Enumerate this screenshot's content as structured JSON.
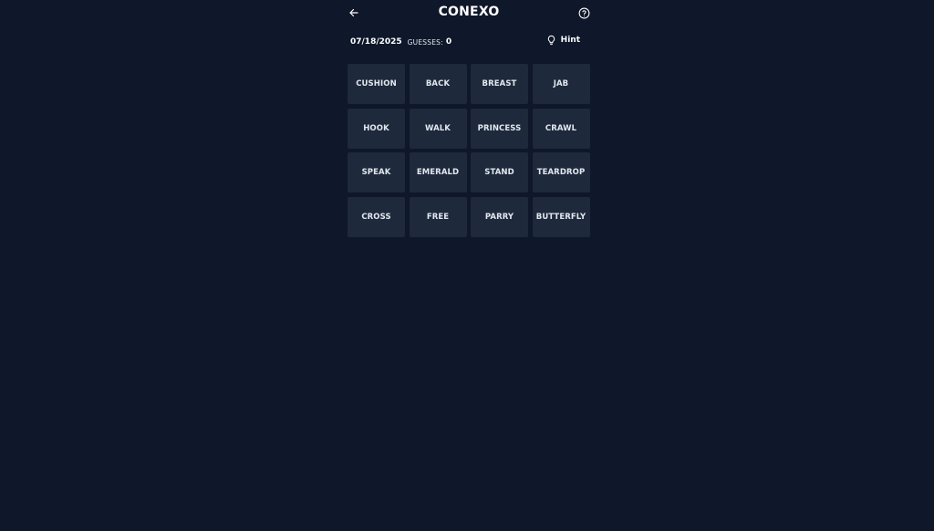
{
  "header": {
    "title": "CONEXO",
    "back_icon": "arrow-left-icon",
    "help_icon": "question-circle-icon"
  },
  "meta": {
    "date": "07/18/2025",
    "guesses_label": "GUESSES:",
    "guesses_count": "0",
    "hint_label": "Hint",
    "hint_icon": "lightbulb-icon"
  },
  "grid": {
    "words": [
      "CUSHION",
      "BACK",
      "BREAST",
      "JAB",
      "HOOK",
      "WALK",
      "PRINCESS",
      "CRAWL",
      "SPEAK",
      "EMERALD",
      "STAND",
      "TEARDROP",
      "CROSS",
      "FREE",
      "PARRY",
      "BUTTERFLY"
    ]
  },
  "colors": {
    "background": "#0f172a",
    "tile": "#1e293b",
    "text": "#e2e8f0"
  }
}
